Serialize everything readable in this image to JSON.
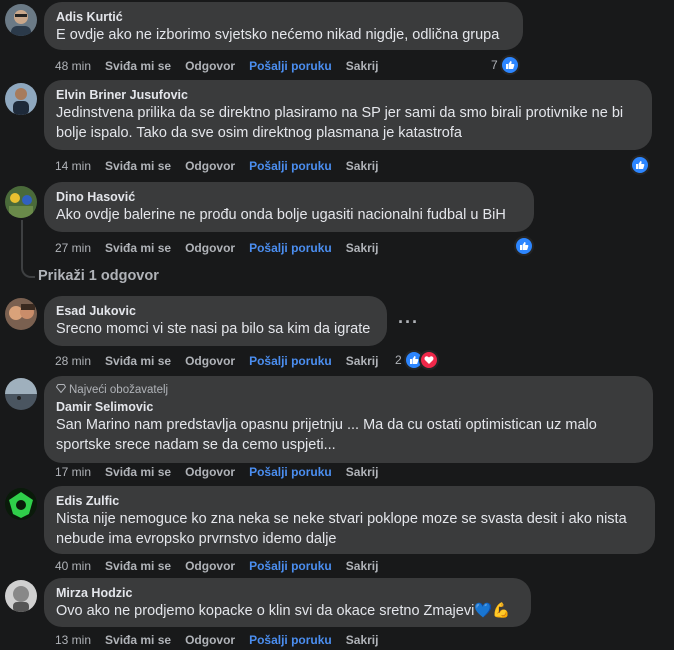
{
  "labels": {
    "like": "Sviđa mi se",
    "reply": "Odgovor",
    "send_message": "Pošalji poruku",
    "hide": "Sakrij"
  },
  "comments": [
    {
      "author": "Adis Kurtić",
      "text": "E ovdje ako ne izborimo svjetsko nećemo nikad nigdje, odlična grupa",
      "time": "48 min",
      "reaction_count": "7"
    },
    {
      "author": "Elvin Briner Jusufovic",
      "text": "Jedinstvena prilika da se direktno plasiramo na SP jer sami da smo birali protivnike ne bi bolje ispalo. Tako da sve osim direktnog plasmana je katastrofa",
      "time": "14 min",
      "reaction_count": ""
    },
    {
      "author": "Dino Hasović",
      "text": "Ako ovdje balerine ne prođu onda bolje ugasiti nacionalni fudbal u BiH",
      "time": "27 min",
      "reaction_count": "",
      "view_replies": "Prikaži 1 odgovor"
    },
    {
      "author": "Esad Jukovic",
      "text": "Srecno momci vi ste nasi pa bilo sa kim da igrate",
      "time": "28 min",
      "reaction_count": "2",
      "more": "···"
    },
    {
      "author": "Damir Selimovic",
      "badge": "Najveći obožavatelj",
      "text": "San Marino nam predstavlja opasnu prijetnju ... Ma da cu ostati optimistican uz malo sportske srece nadam se da cemo uspjeti...",
      "time": "17 min",
      "reaction_count": ""
    },
    {
      "author": "Edis Zulfic",
      "text": "Nista nije nemoguce ko zna neka se neke stvari poklope moze se svasta desit i ako nista nebude ima evropsko prvrnstvo idemo dalje",
      "time": "40 min",
      "reaction_count": ""
    },
    {
      "author": "Mirza Hodzic",
      "text": "Ovo ako ne prodjemo kopacke o klin svi da okace sretno Zmajevi💙💪",
      "time": "13 min",
      "reaction_count": ""
    }
  ],
  "colors": {
    "bubble": "#3a3b3c",
    "link": "#4b8ef0",
    "like": "#2d86ff",
    "heart": "#f0284a"
  },
  "icons": [
    "like-icon",
    "heart-icon",
    "diamond-icon",
    "more-icon"
  ]
}
